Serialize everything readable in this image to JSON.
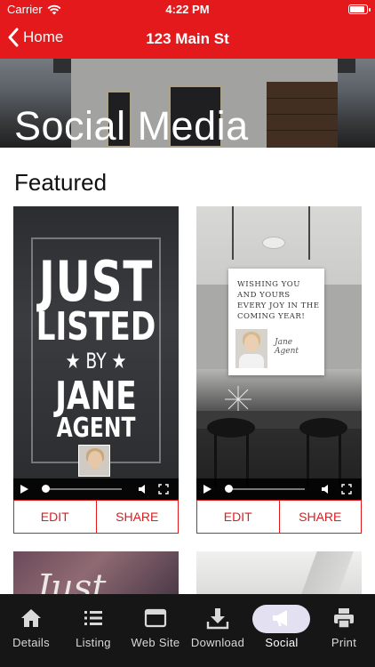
{
  "status_bar": {
    "carrier": "Carrier",
    "time": "4:22 PM"
  },
  "nav": {
    "back_label": "Home",
    "title": "123 Main St"
  },
  "hero": {
    "title": "Social Media"
  },
  "section": {
    "title": "Featured"
  },
  "cards": [
    {
      "art": {
        "line1": "JUST",
        "line2": "LISTED",
        "line3": "BY",
        "line4": "JANE",
        "line5": "AGENT"
      },
      "video": {
        "progress": 0.0
      },
      "edit_label": "EDIT",
      "share_label": "SHARE"
    },
    {
      "art": {
        "greeting": "WISHING YOU AND YOURS EVERY JOY IN THE COMING YEAR!",
        "signature_line1": "Jane",
        "signature_line2": "Agent"
      },
      "video": {
        "progress": 0.0
      },
      "edit_label": "EDIT",
      "share_label": "SHARE"
    }
  ],
  "peek_cards": [
    {
      "script_text": "Just"
    }
  ],
  "tab_bar": {
    "active_color": "#e3e0f2",
    "items": [
      {
        "label": "Details",
        "icon": "home-icon"
      },
      {
        "label": "Listing",
        "icon": "list-icon"
      },
      {
        "label": "Web Site",
        "icon": "browser-window-icon"
      },
      {
        "label": "Download",
        "icon": "download-icon"
      },
      {
        "label": "Social",
        "icon": "megaphone-icon",
        "active": true
      },
      {
        "label": "Print",
        "icon": "printer-icon"
      }
    ]
  },
  "colors": {
    "brand_red": "#e3191c",
    "tab_bar_bg": "#161616"
  }
}
